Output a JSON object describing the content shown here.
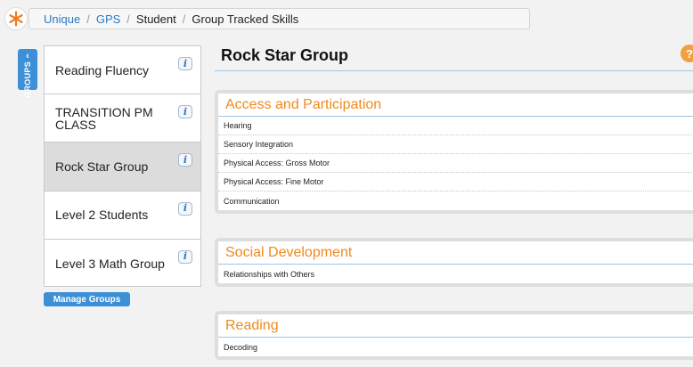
{
  "breadcrumb": {
    "items": [
      "Unique",
      "GPS",
      "Student",
      "Group Tracked Skills"
    ],
    "separator": "/"
  },
  "sidebar": {
    "tab_label": "GROUPS",
    "tab_arrow": "‹",
    "groups": [
      {
        "label": "Reading Fluency",
        "active": false
      },
      {
        "label": "TRANSITION PM CLASS",
        "active": false
      },
      {
        "label": "Rock Star Group",
        "active": true
      },
      {
        "label": "Level 2 Students",
        "active": false
      },
      {
        "label": "Level 3 Math Group",
        "active": false
      }
    ],
    "info_glyph": "i",
    "manage_button": "Manage Groups"
  },
  "main": {
    "title": "Rock Star Group",
    "help_glyph": "?",
    "sections": [
      {
        "title": "Access and Participation",
        "skills": [
          "Hearing",
          "Sensory Integration",
          "Physical Access: Gross Motor",
          "Physical Access: Fine Motor",
          "Communication"
        ]
      },
      {
        "title": "Social Development",
        "skills": [
          "Relationships with Others"
        ]
      },
      {
        "title": "Reading",
        "skills": [
          "Decoding"
        ]
      }
    ]
  },
  "colors": {
    "accent_blue": "#3d8fd6",
    "link_blue": "#2b7ac2",
    "section_orange": "#ee8a1e",
    "logo_orange": "#f07a1a"
  },
  "icons": [
    "snowflake-logo-icon",
    "chevron-left-icon",
    "info-icon",
    "help-icon"
  ]
}
